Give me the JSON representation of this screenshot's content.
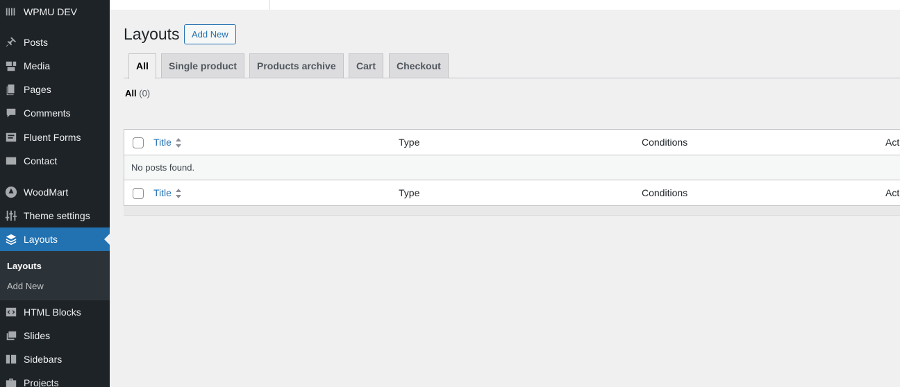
{
  "sidebar": {
    "brand": "WPMU DEV",
    "items": [
      {
        "label": "Posts",
        "icon": "pin-icon"
      },
      {
        "label": "Media",
        "icon": "media-icon"
      },
      {
        "label": "Pages",
        "icon": "pages-icon"
      },
      {
        "label": "Comments",
        "icon": "comments-icon"
      },
      {
        "label": "Fluent Forms",
        "icon": "forms-icon"
      },
      {
        "label": "Contact",
        "icon": "mail-icon"
      },
      {
        "label": "WoodMart",
        "icon": "woodmart-icon"
      },
      {
        "label": "Theme settings",
        "icon": "sliders-icon"
      },
      {
        "label": "Layouts",
        "icon": "layers-icon"
      },
      {
        "label": "HTML Blocks",
        "icon": "code-icon"
      },
      {
        "label": "Slides",
        "icon": "slides-icon"
      },
      {
        "label": "Sidebars",
        "icon": "sidebars-icon"
      },
      {
        "label": "Projects",
        "icon": "briefcase-icon"
      }
    ],
    "submenu": {
      "current": "Layouts",
      "add_new": "Add New"
    }
  },
  "page": {
    "title": "Layouts",
    "add_new": "Add New",
    "tabs": [
      "All",
      "Single product",
      "Products archive",
      "Cart",
      "Checkout"
    ],
    "filter": {
      "label": "All",
      "count": "(0)"
    }
  },
  "table": {
    "columns": {
      "title": "Title",
      "type": "Type",
      "conditions": "Conditions",
      "actions": "Act"
    },
    "empty": "No posts found."
  },
  "colors": {
    "sidebar_bg": "#1d2327",
    "accent": "#2271b1",
    "page_bg": "#f0f0f1"
  }
}
